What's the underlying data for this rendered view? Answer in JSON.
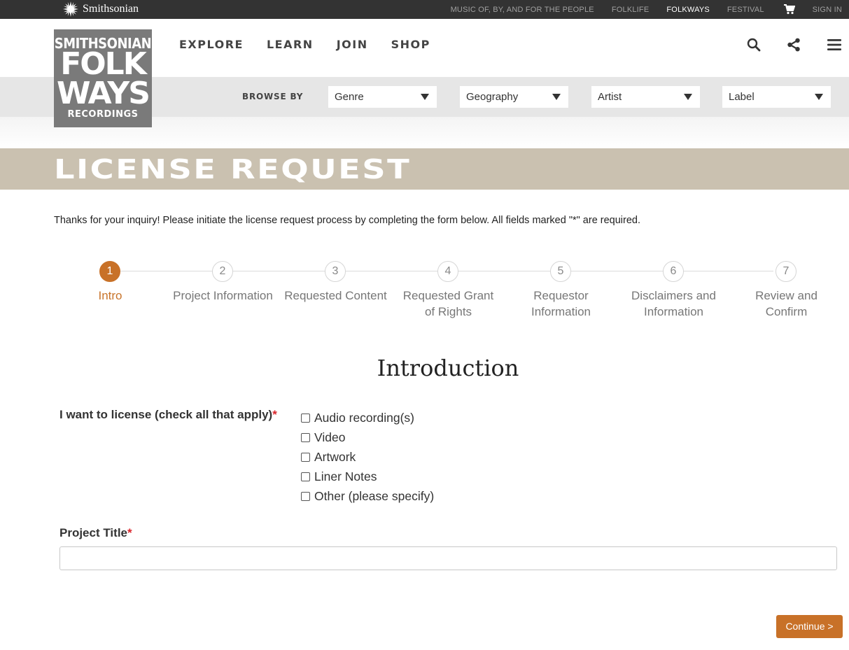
{
  "topbar": {
    "logo_text": "Smithsonian",
    "links": [
      {
        "label": "MUSIC OF, BY, AND FOR THE PEOPLE",
        "active": false
      },
      {
        "label": "FOLKLIFE",
        "active": false
      },
      {
        "label": "FOLKWAYS",
        "active": true
      },
      {
        "label": "FESTIVAL",
        "active": false
      }
    ],
    "cart_icon": "cart-icon",
    "sign_in": "SIGN IN"
  },
  "logo": {
    "line1": "SMITHSONIAN",
    "line2": "FOLK",
    "line3": "WAYS",
    "line4": "RECORDINGS"
  },
  "nav": {
    "items": [
      "EXPLORE",
      "LEARN",
      "JOIN",
      "SHOP"
    ],
    "icons": [
      "search-icon",
      "share-icon",
      "menu-icon"
    ]
  },
  "browse": {
    "label": "BROWSE BY",
    "selects": [
      "Genre",
      "Geography",
      "Artist",
      "Label"
    ]
  },
  "page": {
    "title": "LICENSE REQUEST",
    "intro": "Thanks for your inquiry! Please initiate the license request process by completing the form below. All fields marked \"*\" are required."
  },
  "stepper": {
    "current": 1,
    "steps": [
      {
        "number": "1",
        "label": "Intro"
      },
      {
        "number": "2",
        "label": "Project Information"
      },
      {
        "number": "3",
        "label": "Requested Content"
      },
      {
        "number": "4",
        "label": "Requested Grant of Rights"
      },
      {
        "number": "5",
        "label": "Requestor Information"
      },
      {
        "number": "6",
        "label": "Disclaimers and Information"
      },
      {
        "number": "7",
        "label": "Review and Confirm"
      }
    ]
  },
  "form": {
    "section_title": "Introduction",
    "license_label": "I want to license (check all that apply)",
    "required_mark": "*",
    "license_options": [
      {
        "label": "Audio recording(s)",
        "checked": false
      },
      {
        "label": "Video",
        "checked": false
      },
      {
        "label": "Artwork",
        "checked": false
      },
      {
        "label": "Liner Notes",
        "checked": false
      },
      {
        "label": "Other (please specify)",
        "checked": false
      }
    ],
    "project_title_label": "Project Title",
    "project_title_value": "",
    "continue_label": "Continue >"
  },
  "colors": {
    "topbar_bg": "#333333",
    "accent": "#c87128",
    "banner_bg": "#cac1b0",
    "logo_bg": "#7a7a7a",
    "required": "#d9242b"
  }
}
